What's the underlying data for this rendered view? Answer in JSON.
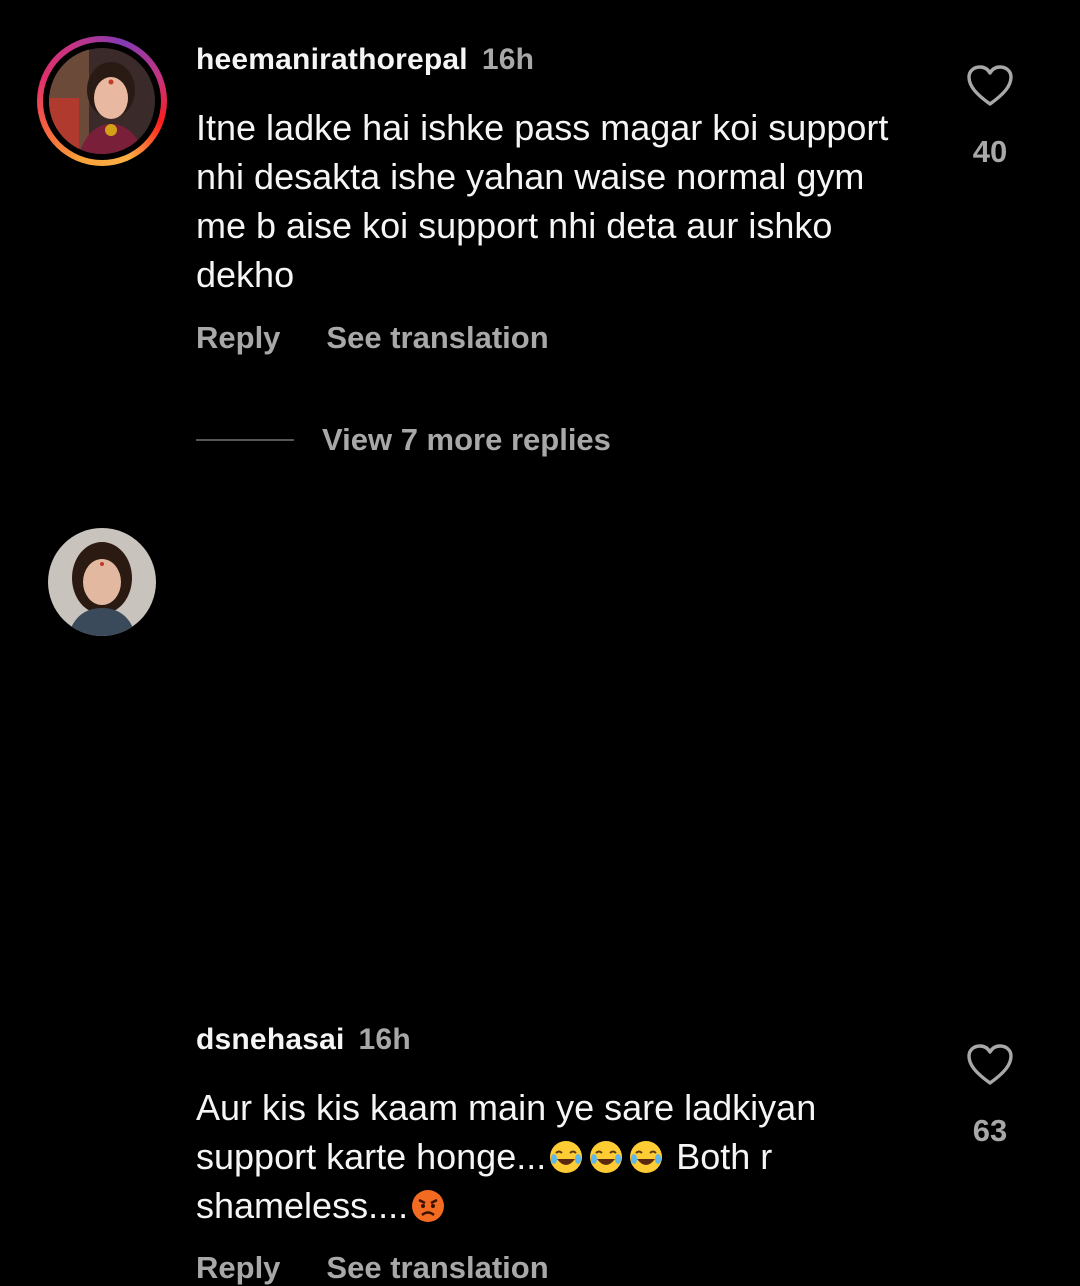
{
  "comments": [
    {
      "username": "heemanirathorepal",
      "time": "16h",
      "text": "Itne ladke hai ishke pass magar koi support nhi desakta ishe yahan waise normal gym me b aise koi support nhi deta aur ishko dekho",
      "likes": "40",
      "reply_label": "Reply",
      "translate_label": "See translation",
      "has_story_ring": true
    },
    {
      "username": "dsnehasai",
      "time": "16h",
      "text_part1": "Aur kis kis kaam main ye sare ladkiyan support karte honge...",
      "emojis_mid": [
        "joy-emoji",
        "joy-emoji",
        "joy-emoji"
      ],
      "text_part2": " Both r shameless....",
      "emoji_end": "angry-emoji",
      "likes": "63",
      "reply_label": "Reply",
      "translate_label": "See translation",
      "has_story_ring": false
    }
  ],
  "view_more": {
    "label": "View 7 more replies"
  },
  "colors": {
    "background": "#000000",
    "primary_text": "#f5f5f5",
    "secondary_text": "#a8a8a8"
  }
}
